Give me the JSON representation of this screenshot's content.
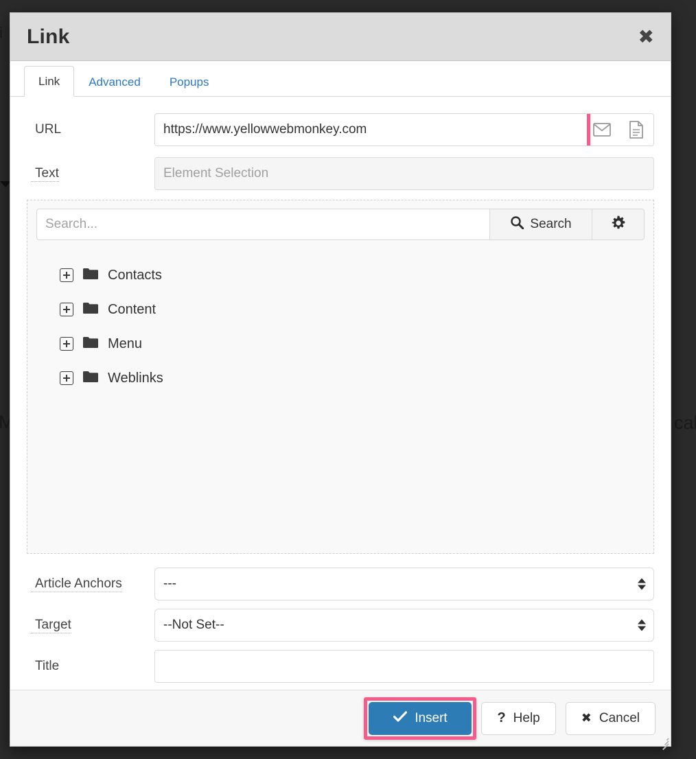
{
  "background": {
    "partial_text_left": "M",
    "partial_text_left_top": "i",
    "partial_text_right": "call"
  },
  "modal": {
    "title": "Link",
    "close_icon": "close-icon",
    "tabs": [
      {
        "label": "Link",
        "active": true
      },
      {
        "label": "Advanced",
        "active": false
      },
      {
        "label": "Popups",
        "active": false
      }
    ],
    "fields": {
      "url": {
        "label": "URL",
        "value": "https://www.yellowwebmonkey.com",
        "placeholder": "",
        "highlighted": true,
        "highlight_color": "#f45c8c",
        "icons": [
          "envelope-icon",
          "document-icon"
        ]
      },
      "text": {
        "label": "Text",
        "value": "",
        "placeholder": "Element Selection"
      },
      "article_anchors": {
        "label": "Article Anchors",
        "value": "---"
      },
      "target": {
        "label": "Target",
        "value": "--Not Set--"
      },
      "title": {
        "label": "Title",
        "value": "",
        "placeholder": ""
      }
    },
    "browser": {
      "search_placeholder": "Search...",
      "search_value": "",
      "search_button": "Search",
      "search_icon": "magnifier-icon",
      "options_icon": "gear-icon",
      "tree": [
        {
          "label": "Contacts"
        },
        {
          "label": "Content"
        },
        {
          "label": "Menu"
        },
        {
          "label": "Weblinks"
        }
      ]
    },
    "footer": {
      "insert": {
        "label": "Insert",
        "icon": "check-icon",
        "highlighted": true
      },
      "help": {
        "label": "Help",
        "icon": "question-icon"
      },
      "cancel": {
        "label": "Cancel",
        "icon": "x-icon"
      }
    }
  },
  "colors": {
    "accent_blue": "#2e7cb5",
    "highlight_pink": "#f45c8c",
    "tab_link_blue": "#2b78c4",
    "backdrop": "#2b2b2b"
  }
}
